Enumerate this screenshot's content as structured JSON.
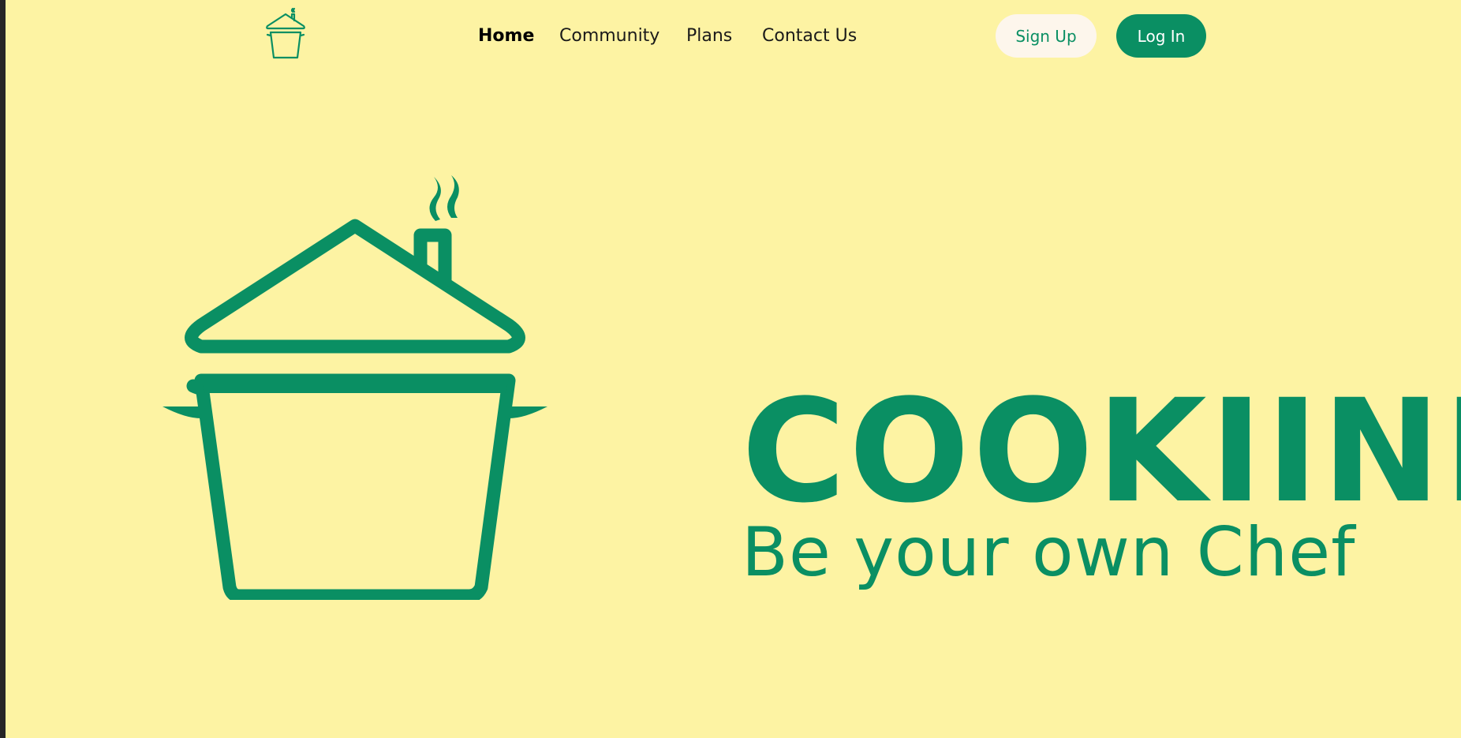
{
  "brand": {
    "logo_icon": "cooking-pot-house-icon",
    "name": "COOKIINI",
    "tagline": "Be your own Chef",
    "accent_color": "#0a8f63",
    "background_color": "#fdf3a3"
  },
  "nav": {
    "items": [
      {
        "label": "Home",
        "active": true
      },
      {
        "label": "Community",
        "active": false
      },
      {
        "label": "Plans",
        "active": false
      },
      {
        "label": "Contact Us",
        "active": false
      }
    ]
  },
  "auth": {
    "signup_label": "Sign Up",
    "login_label": "Log In"
  }
}
